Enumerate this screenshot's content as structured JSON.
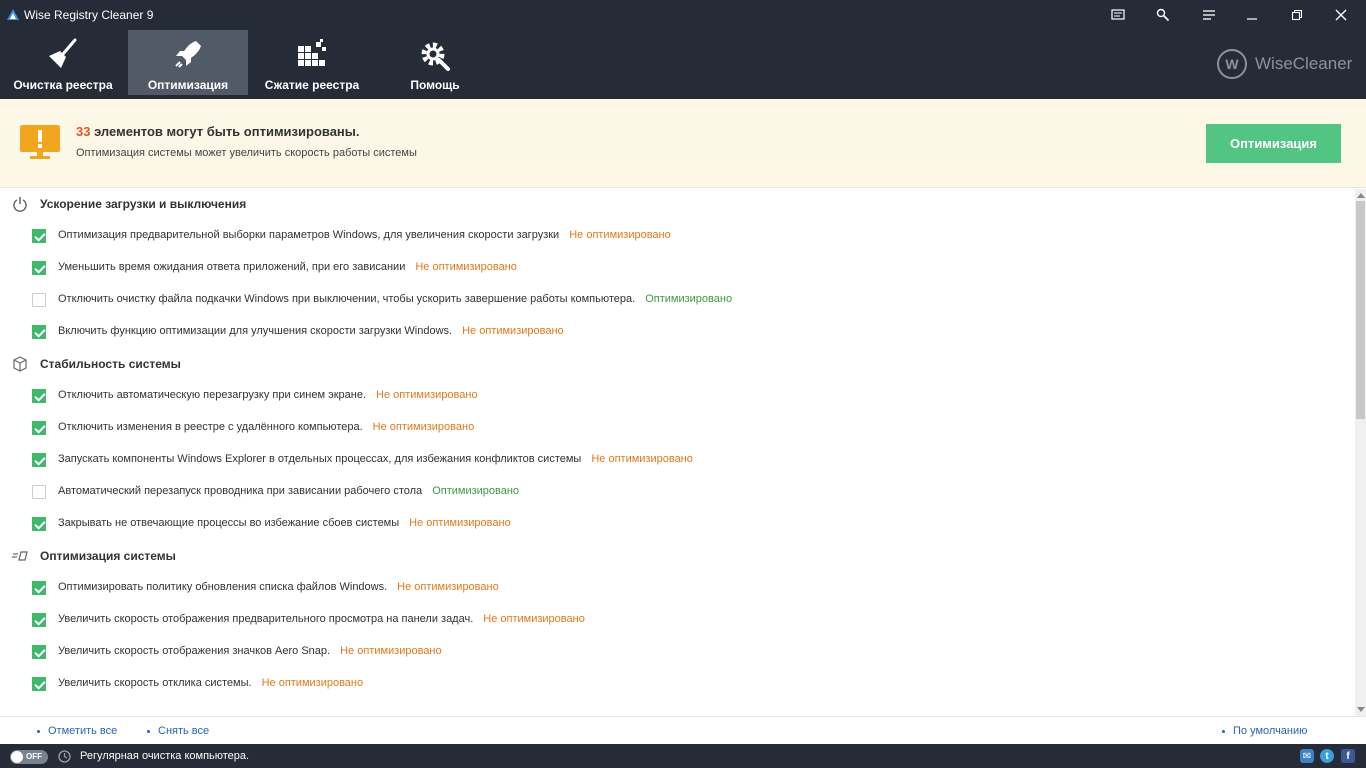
{
  "window": {
    "title": "Wise Registry Cleaner 9"
  },
  "nav": {
    "tabs": [
      {
        "label": "Очистка реестра",
        "icon": "broom-icon"
      },
      {
        "label": "Оптимизация",
        "icon": "rocket-icon",
        "active": true
      },
      {
        "label": "Сжатие реестра",
        "icon": "blocks-icon"
      },
      {
        "label": "Помощь",
        "icon": "gear-wrench-icon"
      }
    ],
    "brand": "WiseCleaner",
    "brand_logo_letter": "W"
  },
  "banner": {
    "count": "33",
    "headline": " элементов могут быть оптимизированы.",
    "subtitle": "Оптимизация системы может увеличить скорость работы системы",
    "button_label": "Оптимизация"
  },
  "categories": [
    {
      "title": "Ускорение загрузки и выключения",
      "icon": "power-icon",
      "items": [
        {
          "label": "Оптимизация предварительной выборки параметров Windows, для увеличения скорости загрузки",
          "status": "Не оптимизировано",
          "checked": true
        },
        {
          "label": "Уменьшить время ожидания ответа приложений, при его зависании",
          "status": "Не оптимизировано",
          "checked": true
        },
        {
          "label": "Отключить очистку файла подкачки Windows при выключении, чтобы ускорить завершение работы компьютера.",
          "status": "Оптимизировано",
          "checked": false
        },
        {
          "label": "Включить функцию оптимизации для улучшения скорости загрузки Windows.",
          "status": "Не оптимизировано",
          "checked": true
        }
      ]
    },
    {
      "title": "Стабильность системы",
      "icon": "cube-icon",
      "items": [
        {
          "label": "Отключить автоматическую перезагрузку при синем экране.",
          "status": "Не оптимизировано",
          "checked": true
        },
        {
          "label": "Отключить изменения в реестре с удалённого компьютера.",
          "status": "Не оптимизировано",
          "checked": true
        },
        {
          "label": "Запускать компоненты Windows Explorer в отдельных процессах, для избежания конфликтов системы",
          "status": "Не оптимизировано",
          "checked": true
        },
        {
          "label": "Автоматический перезапуск проводника при зависании рабочего стола",
          "status": "Оптимизировано",
          "checked": false
        },
        {
          "label": "Закрывать не отвечающие процессы во избежание сбоев системы",
          "status": "Не оптимизировано",
          "checked": true
        }
      ]
    },
    {
      "title": "Оптимизация системы",
      "icon": "speed-icon",
      "items": [
        {
          "label": "Оптимизировать политику обновления списка файлов Windows.",
          "status": "Не оптимизировано",
          "checked": true
        },
        {
          "label": "Увеличить скорость отображения предварительного просмотра на панели задач.",
          "status": "Не оптимизировано",
          "checked": true
        },
        {
          "label": "Увеличить скорость отображения значков Aero Snap.",
          "status": "Не оптимизировано",
          "checked": true
        },
        {
          "label": "Увеличить скорость отклика системы.",
          "status": "Не оптимизировано",
          "checked": true
        }
      ]
    }
  ],
  "footer": {
    "select_all": "Отметить все",
    "deselect_all": "Снять все",
    "default": "По умолчанию"
  },
  "statusbar": {
    "toggle_label": "OFF",
    "text": "Регулярная очистка компьютера."
  },
  "colors": {
    "chrome": "#252b37",
    "active_tab": "#525a68",
    "accent_green": "#52c483",
    "not_optimized": "#e0791e",
    "optimized": "#3b9b46",
    "count": "#e4572e"
  }
}
